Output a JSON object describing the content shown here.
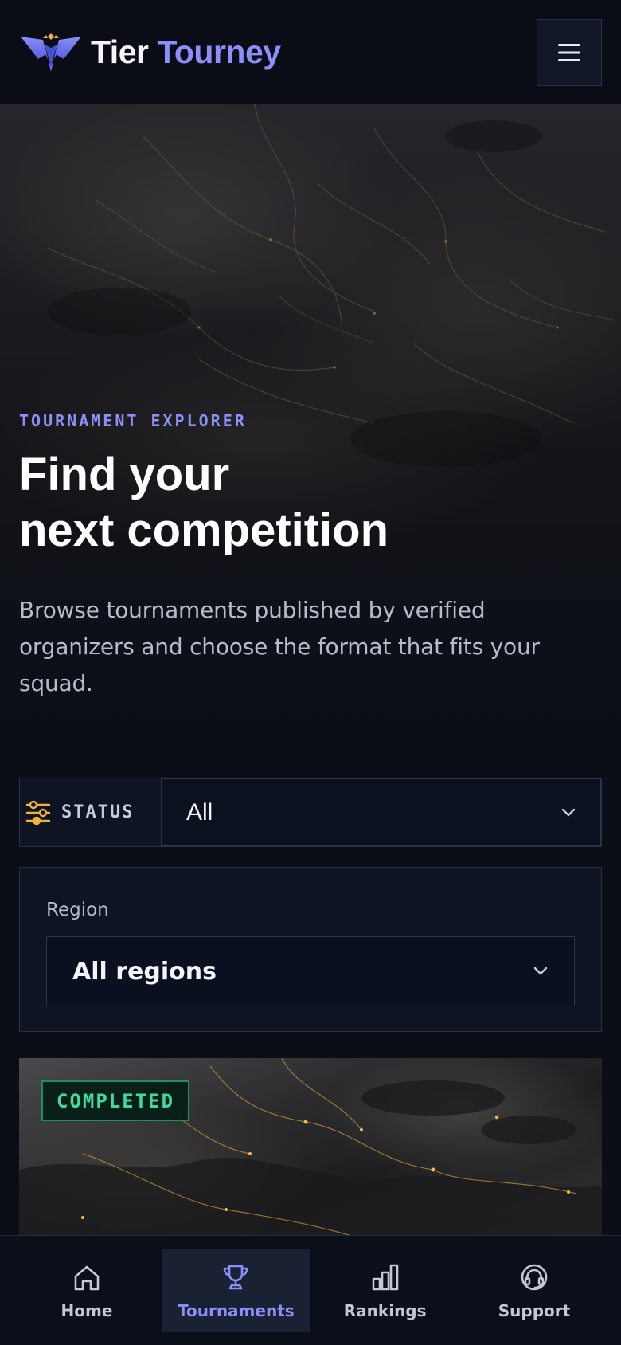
{
  "header": {
    "brand_word1": "Tier",
    "brand_word2": "Tourney",
    "logo_icon": "winged-shield-logo-icon",
    "menu_icon": "hamburger-menu-icon"
  },
  "hero": {
    "eyebrow": "TOURNAMENT EXPLORER",
    "title_line1": "Find your",
    "title_line2": "next competition",
    "description": "Browse tournaments published by verified organizers and choose the format that fits your squad."
  },
  "filters": {
    "status": {
      "label": "STATUS",
      "icon": "sliders-icon",
      "value": "All"
    },
    "region": {
      "label": "Region",
      "value": "All regions"
    }
  },
  "card": {
    "badge": "COMPLETED"
  },
  "bottom_nav": {
    "items": [
      {
        "label": "Home",
        "icon": "home-icon",
        "active": false
      },
      {
        "label": "Tournaments",
        "icon": "trophy-icon",
        "active": true
      },
      {
        "label": "Rankings",
        "icon": "bar-chart-icon",
        "active": false
      },
      {
        "label": "Support",
        "icon": "headset-icon",
        "active": false
      }
    ]
  },
  "colors": {
    "accent": "#8b8ff7",
    "status_completed": "#3ddc9b",
    "filter_icon": "#f0b23a",
    "background": "#0b0e17"
  }
}
